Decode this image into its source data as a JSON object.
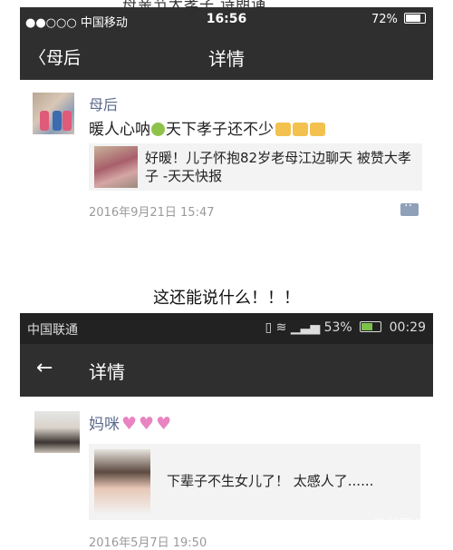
{
  "top_crop_text": "母亲节大孝子 诗朗诵",
  "shot1": {
    "status": {
      "left": "●●○○○ 中国移动",
      "time": "16:56",
      "battery": "72%"
    },
    "nav": {
      "back_label": "〈母后",
      "title": "详情"
    },
    "post": {
      "user": "母后",
      "text_before": "暖人心呐",
      "text_after": "天下孝子还不少",
      "card_text": "好暖！儿子怀抱82岁老母江边聊天 被赞大孝子 -天天快报",
      "time": "2016年9月21日 15:47"
    }
  },
  "caption": "这还能说什么！！！",
  "shot2": {
    "status": {
      "left": "中国联通",
      "battery": "53%",
      "time": "00:29"
    },
    "nav": {
      "back_label": "←",
      "title": "详情"
    },
    "post": {
      "user": "妈咪",
      "card_text": "下辈子不生女儿了！ 太感人了......",
      "time": "2016年5月7日 19:50"
    },
    "watermark": "别逗了"
  },
  "colors": {
    "bar_dark": "#2f2f2f",
    "name_blue": "#5b6b8c",
    "time_gray": "#9a9a9a",
    "heart_pink": "#e884c2"
  }
}
